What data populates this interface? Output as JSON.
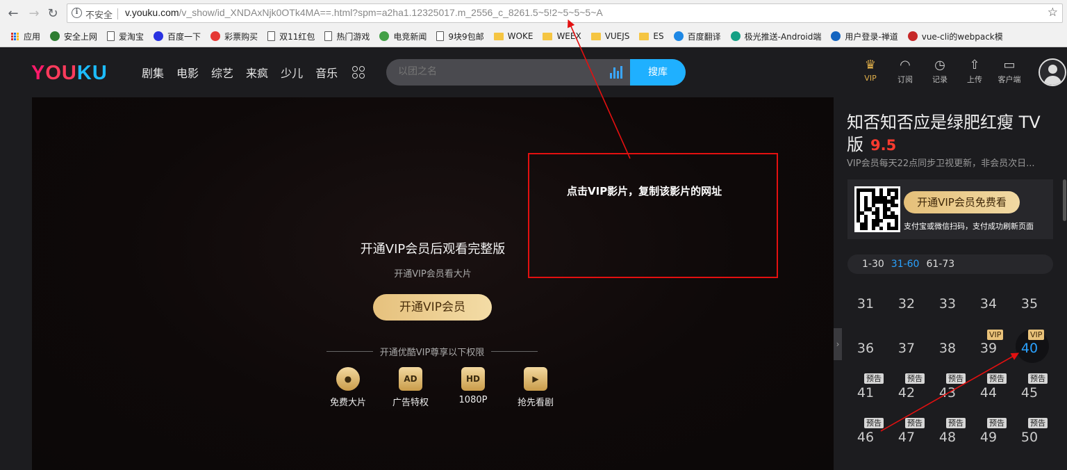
{
  "browser": {
    "insecure_label": "不安全",
    "url_host": "v.youku.com",
    "url_path": "/v_show/id_XNDAxNjk0OTk4MA==.html?spm=a2ha1.12325017.m_2556_c_8261.5~5!2~5~5~5~A",
    "bookmarks": [
      {
        "label": "应用",
        "icon": "apps-icon"
      },
      {
        "label": "安全上网",
        "icon": "shield-icon"
      },
      {
        "label": "爱淘宝",
        "icon": "page-icon"
      },
      {
        "label": "百度一下",
        "icon": "baidu-icon"
      },
      {
        "label": "彩票购买",
        "icon": "lottery-icon"
      },
      {
        "label": "双11红包",
        "icon": "page-icon"
      },
      {
        "label": "热门游戏",
        "icon": "page-icon"
      },
      {
        "label": "电竞新闻",
        "icon": "game-icon"
      },
      {
        "label": "9块9包邮",
        "icon": "page-icon"
      },
      {
        "label": "WOKE",
        "icon": "folder-icon"
      },
      {
        "label": "WEEX",
        "icon": "folder-icon"
      },
      {
        "label": "VUEJS",
        "icon": "folder-icon"
      },
      {
        "label": "ES",
        "icon": "folder-icon"
      },
      {
        "label": "百度翻译",
        "icon": "translate-icon"
      },
      {
        "label": "极光推送-Android端",
        "icon": "jpush-icon"
      },
      {
        "label": "用户登录-禅道",
        "icon": "globe-icon"
      },
      {
        "label": "vue-cli的webpack模",
        "icon": "csdn-icon"
      }
    ]
  },
  "header": {
    "logo": [
      "Y",
      "O",
      "U",
      "K",
      "U"
    ],
    "menu": [
      "剧集",
      "电影",
      "综艺",
      "来疯",
      "少儿",
      "音乐"
    ],
    "search_placeholder": "以团之名",
    "search_button": "搜库",
    "icons": [
      {
        "label": "VIP",
        "icon": "crown-icon",
        "glyph": "♛"
      },
      {
        "label": "订阅",
        "icon": "rss-icon",
        "glyph": "◠"
      },
      {
        "label": "记录",
        "icon": "clock-icon",
        "glyph": "◷"
      },
      {
        "label": "上传",
        "icon": "upload-icon",
        "glyph": "⇧"
      },
      {
        "label": "客户端",
        "icon": "monitor-icon",
        "glyph": "▭"
      }
    ]
  },
  "player": {
    "title": "开通VIP会员后观看完整版",
    "subtitle": "开通VIP会员看大片",
    "button": "开通VIP会员",
    "privilege_heading": "开通优酷VIP尊享以下权限",
    "perks": [
      {
        "label": "免费大片",
        "glyph": "●"
      },
      {
        "label": "广告特权",
        "glyph": "AD"
      },
      {
        "label": "1080P",
        "glyph": "HD"
      },
      {
        "label": "抢先看剧",
        "glyph": "▶"
      }
    ]
  },
  "annotation": {
    "text": "点击VIP影片，复制该影片的网址",
    "color": "#e31010"
  },
  "sidebar": {
    "title": "知否知否应是绿肥红瘦 TV版",
    "score": "9.5",
    "description": "VIP会员每天22点同步卫视更新，非会员次日...",
    "vip_button": "开通VIP会员免费看",
    "vip_hint": "支付宝或微信扫码，支付成功刷新页面",
    "ranges": [
      {
        "label": "1-30",
        "active": false
      },
      {
        "label": "31-60",
        "active": true
      },
      {
        "label": "61-73",
        "active": false
      }
    ],
    "episodes": [
      {
        "num": "31",
        "tag": ""
      },
      {
        "num": "32",
        "tag": ""
      },
      {
        "num": "33",
        "tag": ""
      },
      {
        "num": "34",
        "tag": ""
      },
      {
        "num": "35",
        "tag": ""
      },
      {
        "num": "36",
        "tag": ""
      },
      {
        "num": "37",
        "tag": ""
      },
      {
        "num": "38",
        "tag": ""
      },
      {
        "num": "39",
        "tag": "VIP"
      },
      {
        "num": "40",
        "tag": "VIP",
        "active": true
      },
      {
        "num": "41",
        "tag": "预告"
      },
      {
        "num": "42",
        "tag": "预告"
      },
      {
        "num": "43",
        "tag": "预告"
      },
      {
        "num": "44",
        "tag": "预告"
      },
      {
        "num": "45",
        "tag": "预告"
      },
      {
        "num": "46",
        "tag": "预告"
      },
      {
        "num": "47",
        "tag": "预告"
      },
      {
        "num": "48",
        "tag": "预告"
      },
      {
        "num": "49",
        "tag": "预告"
      },
      {
        "num": "50",
        "tag": "预告"
      }
    ]
  },
  "colors": {
    "accent_blue": "#1fb0ff",
    "vip_gold": "#e9c27a",
    "score_red": "#ff3b2f"
  }
}
